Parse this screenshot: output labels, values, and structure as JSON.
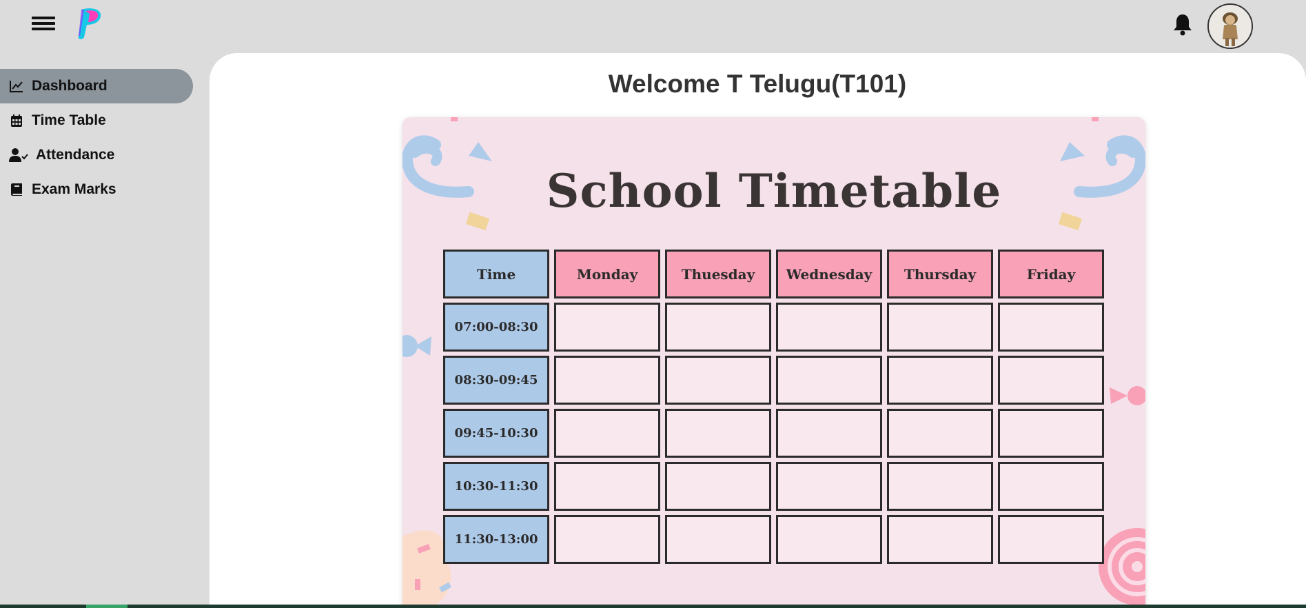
{
  "header": {
    "menu_icon": "hamburger-menu-icon",
    "logo_icon": "brand-logo",
    "notification_icon": "bell-icon",
    "avatar_icon": "user-avatar"
  },
  "sidebar": {
    "items": [
      {
        "label": "Dashboard",
        "icon": "chart-line-icon",
        "active": true
      },
      {
        "label": "Time Table",
        "icon": "calendar-icon",
        "active": false
      },
      {
        "label": "Attendance",
        "icon": "user-check-icon",
        "active": false
      },
      {
        "label": "Exam Marks",
        "icon": "book-icon",
        "active": false
      }
    ]
  },
  "main": {
    "welcome": "Welcome T Telugu(T101)"
  },
  "timetable": {
    "title": "School Timetable",
    "time_header": "Time",
    "days": [
      "Monday",
      "Thuesday",
      "Wednesday",
      "Thursday",
      "Friday"
    ],
    "slots": [
      "07:00-08:30",
      "08:30-09:45",
      "09:45-10:30",
      "10:30-11:30",
      "11:30-13:00"
    ]
  },
  "colors": {
    "sidebar_active": "#8c949c",
    "time_cell": "#adc9e8",
    "day_header": "#f8a1b7",
    "slot_cell": "#f9e8ee",
    "card_bg": "#f5e1e9"
  }
}
